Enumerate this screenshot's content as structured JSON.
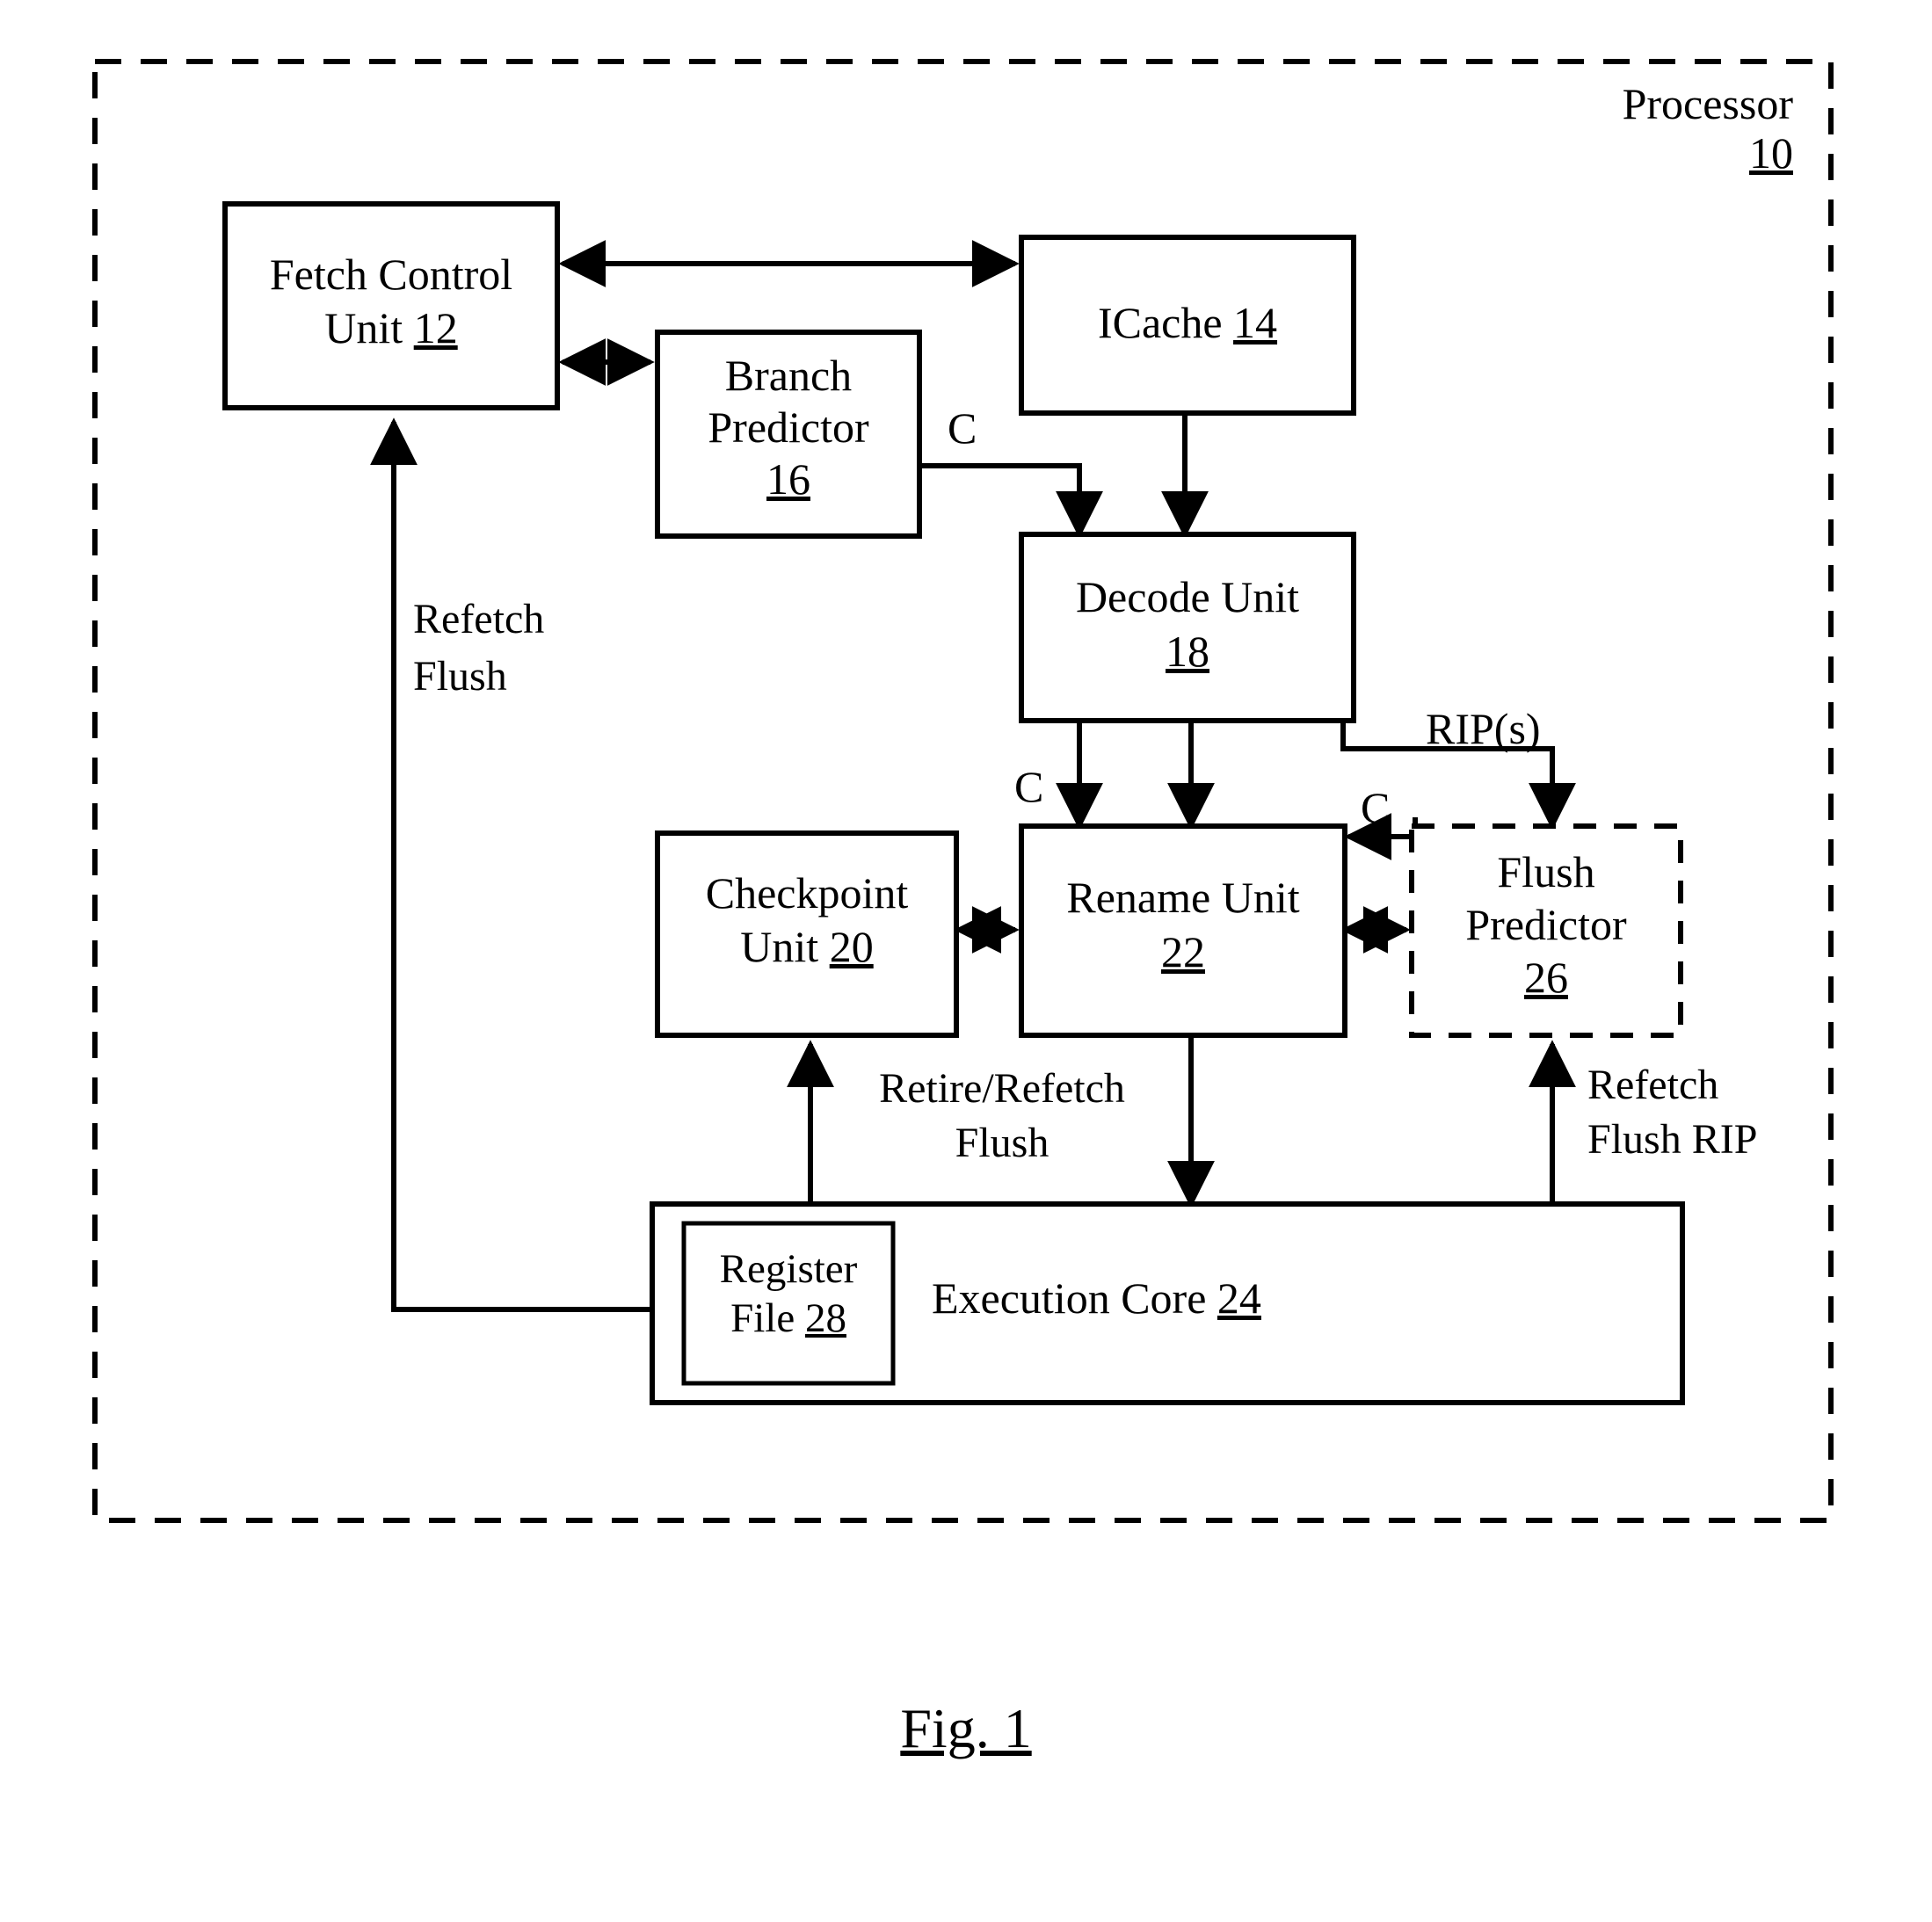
{
  "figure": {
    "caption": "Fig. 1",
    "outer_block": {
      "label": "Processor",
      "ref": "10",
      "border_style": "dashed"
    }
  },
  "blocks": [
    {
      "id": "fetch-control-unit",
      "line1": "Fetch Control",
      "line2": "Unit",
      "ref": "12",
      "border_style": "solid"
    },
    {
      "id": "branch-predictor",
      "line1": "Branch",
      "line2": "Predictor",
      "ref": "16",
      "border_style": "solid"
    },
    {
      "id": "icache",
      "line1": "ICache",
      "line2": "",
      "ref": "14",
      "border_style": "solid"
    },
    {
      "id": "decode-unit",
      "line1": "Decode Unit",
      "line2": "",
      "ref": "18",
      "border_style": "solid"
    },
    {
      "id": "checkpoint-unit",
      "line1": "Checkpoint",
      "line2": "Unit",
      "ref": "20",
      "border_style": "solid"
    },
    {
      "id": "rename-unit",
      "line1": "Rename Unit",
      "line2": "",
      "ref": "22",
      "border_style": "solid"
    },
    {
      "id": "flush-predictor",
      "line1": "Flush",
      "line2": "Predictor",
      "ref": "26",
      "border_style": "dashed"
    },
    {
      "id": "execution-core",
      "line1": "Execution Core",
      "line2": "",
      "ref": "24",
      "border_style": "solid"
    },
    {
      "id": "register-file",
      "line1": "Register",
      "line2": "File",
      "ref": "28",
      "border_style": "solid"
    }
  ],
  "edge_labels": {
    "refetch_flush_left_line1": "Refetch",
    "refetch_flush_left_line2": "Flush",
    "c_branch_to_decode": "C",
    "c_decode_to_rename": "C",
    "c_flush_to_rename": "C",
    "rips": "RIP(s)",
    "retire_refetch_flush_line1": "Retire/Refetch",
    "retire_refetch_flush_line2": "Flush",
    "refetch_flush_rip_line1": "Refetch",
    "refetch_flush_rip_line2": "Flush RIP"
  },
  "colors": {
    "ink": "#000000",
    "paper": "#ffffff"
  }
}
